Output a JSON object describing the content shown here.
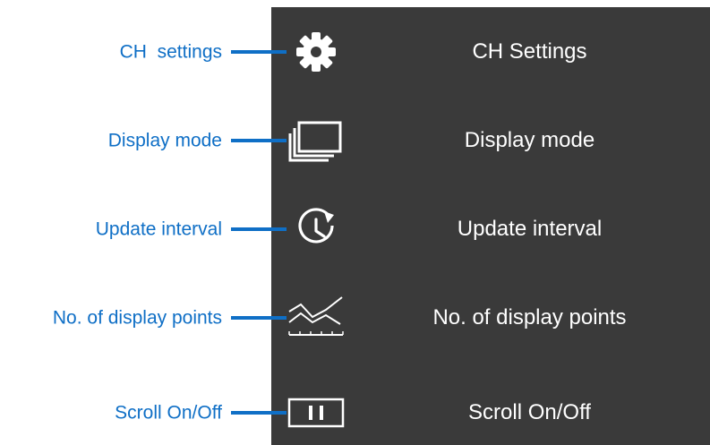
{
  "items": [
    {
      "id": "ch-settings",
      "callout": "CH  settings",
      "label": "CH Settings",
      "icon": "gear-icon"
    },
    {
      "id": "display-mode",
      "callout": "Display mode",
      "label": "Display mode",
      "icon": "windows-icon"
    },
    {
      "id": "update-interval",
      "callout": "Update interval",
      "label": "Update interval",
      "icon": "clock-refresh-icon"
    },
    {
      "id": "display-points",
      "callout": "No. of display points",
      "label": "No. of display points",
      "icon": "points-chart-icon"
    },
    {
      "id": "scroll",
      "callout": "Scroll On/Off",
      "label": "Scroll On/Off",
      "icon": "pause-icon"
    }
  ],
  "colors": {
    "callout": "#0f6fc6",
    "panel": "#3a3a3a",
    "menu_text": "#ffffff"
  }
}
